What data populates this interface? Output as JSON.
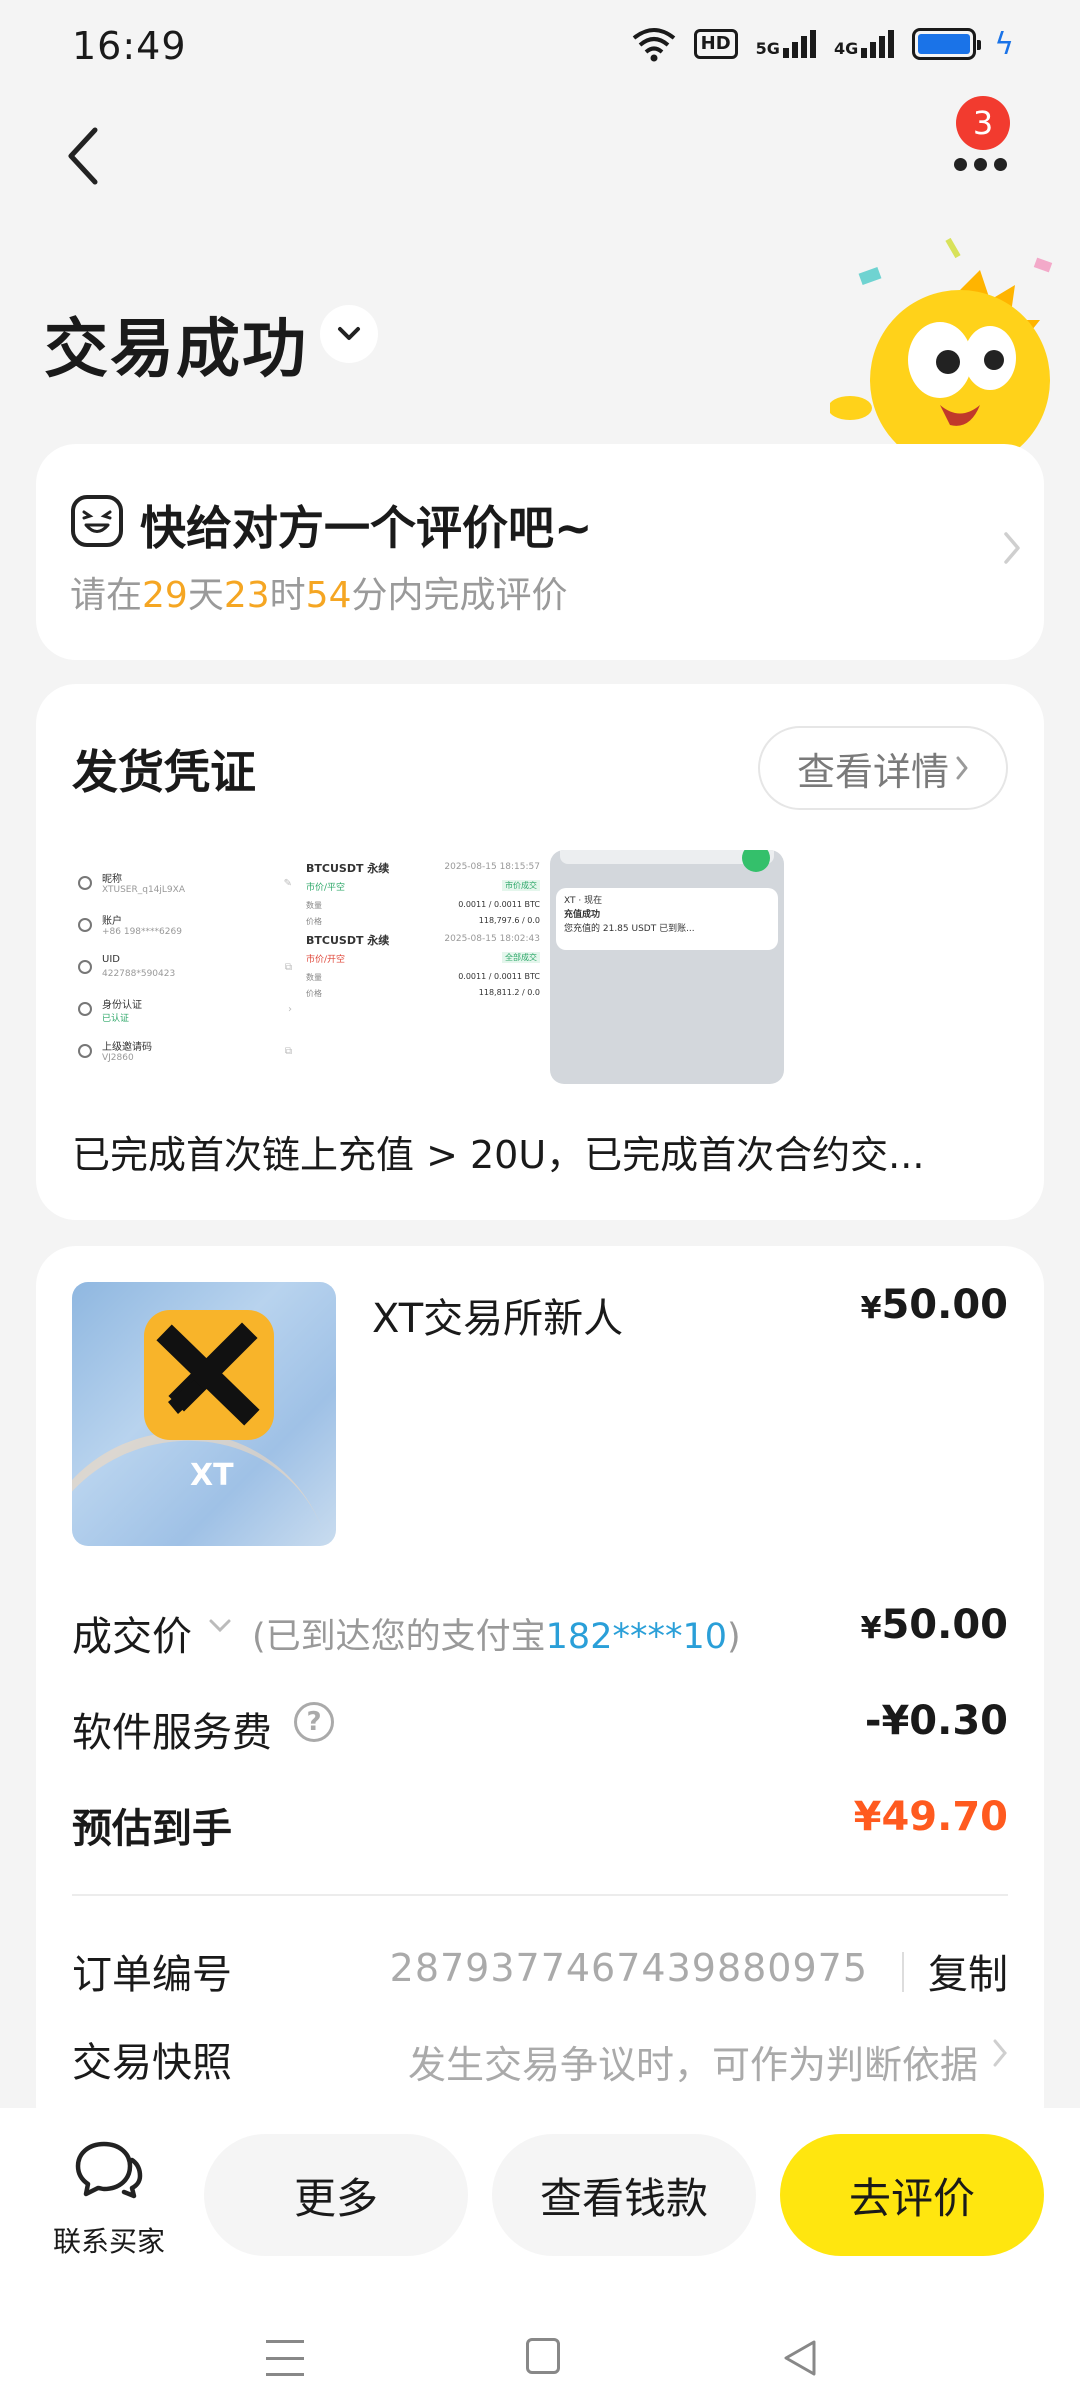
{
  "status_bar": {
    "time": "16:49",
    "hd_badge": "HD",
    "net1": "5G",
    "net2": "4G"
  },
  "header": {
    "notification_count": "3",
    "status_title": "交易成功"
  },
  "review": {
    "title": "快给对方一个评价吧~",
    "prefix": "请在",
    "days": "29",
    "days_unit": "天",
    "hours": "23",
    "hours_unit": "时",
    "minutes": "54",
    "minutes_unit": "分内完成评价"
  },
  "proof": {
    "title": "发货凭证",
    "detail_label": "查看详情",
    "description": "已完成首次链上充值 > 20U，已完成首次合约交...",
    "thumb1": [
      {
        "l1": "昵称",
        "l2": "XTUSER_q14jL9XA"
      },
      {
        "l1": "账户",
        "l2": "+86 198****6269"
      },
      {
        "l1": "UID",
        "l2": "422788*590423"
      },
      {
        "l1": "身份认证",
        "l2": "已认证"
      },
      {
        "l1": "上级邀请码",
        "l2": "VJ2860"
      }
    ],
    "thumb2": [
      {
        "title": "BTCUSDT 永续",
        "date": "2025-08-15 18:15:57",
        "tag": "市价成交",
        "sub": "市价/平空",
        "k1": "数量",
        "v1": "0.0011 / 0.0011 BTC",
        "k2": "价格",
        "v2": "118,797.6 / 0.0"
      },
      {
        "title": "BTCUSDT 永续",
        "date": "2025-08-15 18:02:43",
        "tag": "全部成交",
        "sub": "市价/开空",
        "k1": "数量",
        "v1": "0.0011 / 0.0011 BTC",
        "k2": "价格",
        "v2": "118,811.2 / 0.0"
      }
    ],
    "thumb3": {
      "line1": "XT · 现在",
      "line2": "充值成功",
      "line3": "您充值的 21.85 USDT 已到账..."
    }
  },
  "order": {
    "product_name": "XT交易所新人",
    "product_logo_text": "XT",
    "product_price": "50.00",
    "currency": "¥",
    "deal_label": "成交价",
    "deal_note_prefix": "(已到达您的支付宝",
    "deal_note_account": "182****10",
    "deal_note_suffix": ")",
    "deal_value": "50.00",
    "fee_label": "软件服务费",
    "fee_value": "-¥0.30",
    "estimate_label": "预估到手",
    "estimate_value": "¥49.70",
    "order_no_label": "订单编号",
    "order_no": "2879377467439880975",
    "copy_label": "复制",
    "snapshot_label": "交易快照",
    "snapshot_text": "发生交易争议时，可作为判断依据"
  },
  "bottom": {
    "contact_label": "联系买家",
    "more_label": "更多",
    "view_money_label": "查看钱款",
    "review_label": "去评价"
  },
  "colors": {
    "accent_yellow": "#ffe60f",
    "countdown_orange": "#f5a623",
    "estimate_orange": "#ff5a1f",
    "link_blue": "#2a9fd8",
    "badge_red": "#f23b2f"
  }
}
